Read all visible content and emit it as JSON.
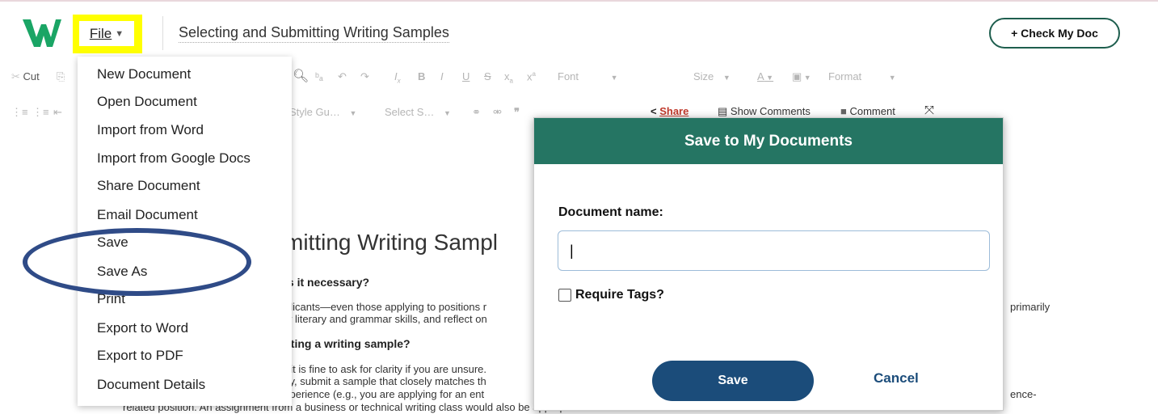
{
  "header": {
    "file_label": "File",
    "doc_title": "Selecting and Submitting Writing Samples",
    "check_btn": "+ Check My Doc"
  },
  "toolbar": {
    "cut": "Cut",
    "font": "Font",
    "size": "Size",
    "format": "Format",
    "style_guide": "Style Gu…",
    "select": "Select S…",
    "share": "Share",
    "show_comments": "Show Comments",
    "comment": "Comment"
  },
  "file_menu": {
    "items": [
      "New Document",
      "Open Document",
      "Import from Word",
      "Import from Google Docs",
      "Share Document",
      "Email Document",
      "Save",
      "Save As",
      "Print",
      "Export to Word",
      "Export to PDF",
      "Document Details"
    ]
  },
  "document": {
    "heading_fragment": "mitting Writing Sampl",
    "q1_fragment": "is it necessary?",
    "p1_line1": "plicants—even those applying to positions r",
    "p1_line2": "w literary and grammar skills, and reflect on",
    "p1_right": "primarily",
    "q2_fragment": "cting a writing sample?",
    "p2_line1": "; it is fine to ask for clarity if you are unsure.",
    "p2_line2": "ify, submit a sample that closely matches th",
    "p2_line3": "xperience (e.g., you are applying for an ent",
    "p2_right": "ence-",
    "p2_line4": "related position. An assignment from a business or technical writing class would also be appropriate."
  },
  "modal": {
    "title": "Save to My Documents",
    "name_label": "Document name:",
    "name_value": "|",
    "require_tags_label": "Require Tags?",
    "require_tags_checked": false,
    "save_label": "Save",
    "cancel_label": "Cancel"
  },
  "colors": {
    "brand_green": "#257563",
    "highlight_yellow": "#ffff00",
    "annotation_oval": "#2f4b87",
    "primary_button": "#1b4c7a"
  }
}
